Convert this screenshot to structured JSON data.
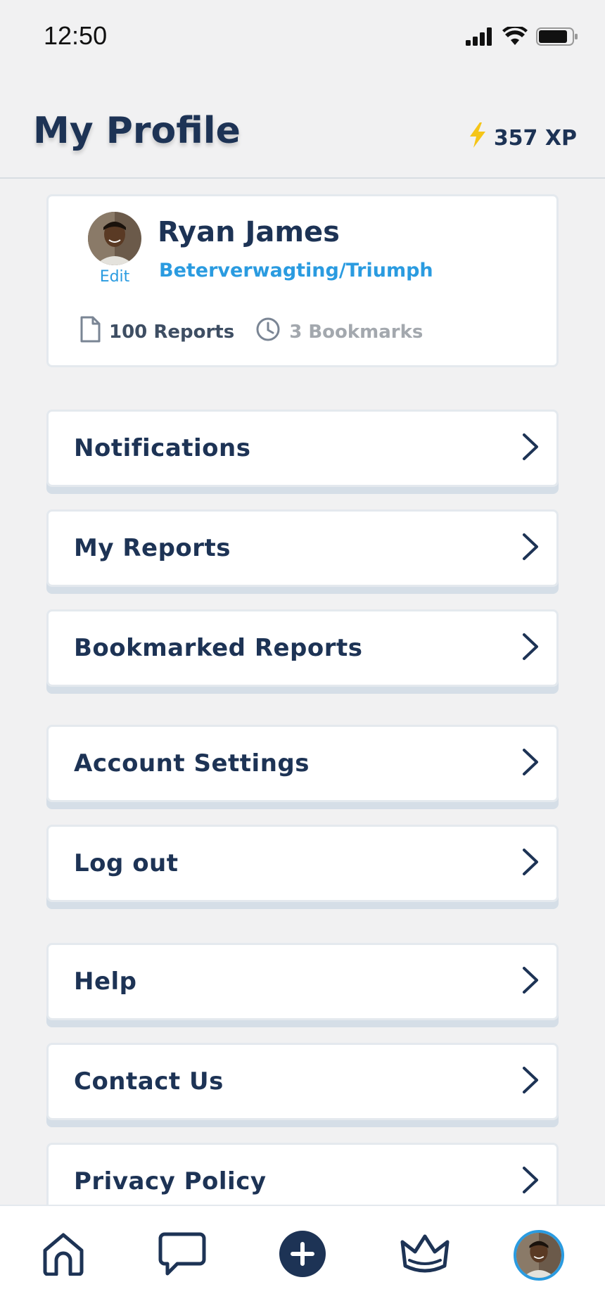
{
  "status_bar": {
    "time": "12:50"
  },
  "header": {
    "title": "My Profile",
    "xp": "357 XP",
    "xp_icon": "lightning-icon"
  },
  "profile": {
    "name": "Ryan James",
    "location": "Beterverwagting/Triumph",
    "edit_label": "Edit",
    "reports": "100 Reports",
    "bookmarks": "3 Bookmarks"
  },
  "menu": [
    {
      "label": "Notifications"
    },
    {
      "label": "My Reports"
    },
    {
      "label": "Bookmarked Reports"
    },
    {
      "label": "Account Settings"
    },
    {
      "label": "Log out"
    },
    {
      "label": "Help"
    },
    {
      "label": "Contact Us"
    },
    {
      "label": "Privacy Policy"
    }
  ],
  "tab_bar": {
    "tabs": [
      "home-icon",
      "chat-icon",
      "add-icon",
      "crown-icon",
      "profile-avatar"
    ]
  },
  "colors": {
    "primary": "#1d3355",
    "accent": "#2a9be0",
    "xp": "#f5c518",
    "background": "#f1f1f2"
  }
}
